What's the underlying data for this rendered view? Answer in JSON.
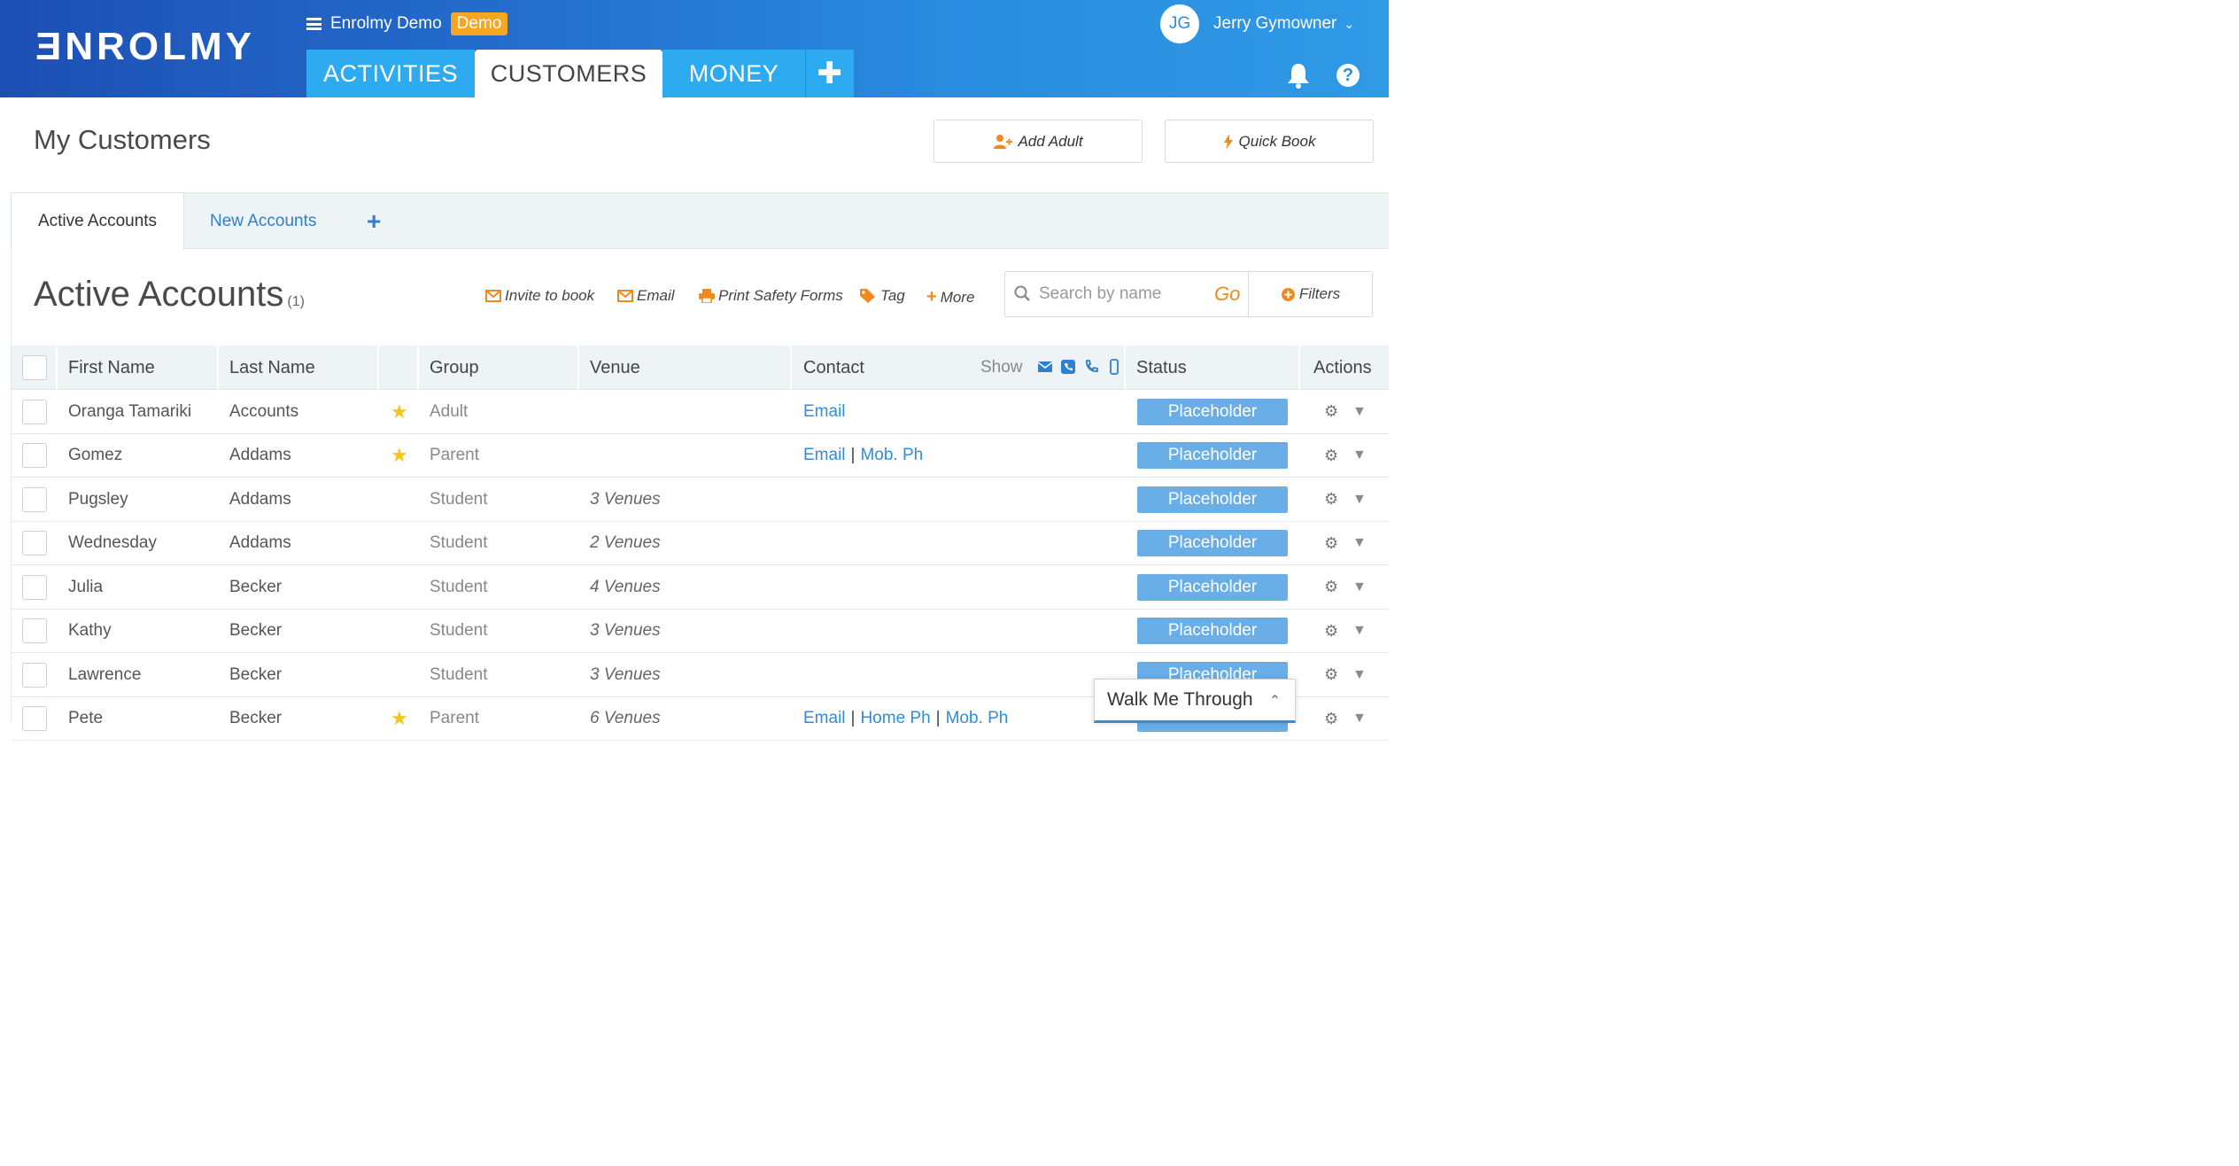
{
  "header": {
    "logo": "ƎNROLMY",
    "org_name": "Enrolmy Demo",
    "org_badge": "Demo",
    "nav_tabs": [
      {
        "label": "ACTIVITIES"
      },
      {
        "label": "CUSTOMERS"
      },
      {
        "label": "MONEY"
      },
      {
        "label": "✚"
      }
    ],
    "user_initials": "JG",
    "user_name": "Jerry Gymowner",
    "help_label": "?"
  },
  "page": {
    "title": "My Customers",
    "add_adult_label": "Add Adult",
    "quick_book_label": "Quick Book"
  },
  "subtabs": {
    "active": "Active Accounts",
    "new": "New Accounts",
    "plus": "+"
  },
  "section": {
    "title": "Active Accounts",
    "count": "(1)",
    "toolbar": {
      "invite": "Invite to book",
      "email": "Email",
      "print": "Print Safety Forms",
      "tag": "Tag",
      "more": "More"
    },
    "search": {
      "placeholder": "Search by name",
      "go": "Go",
      "filters": "Filters"
    }
  },
  "table": {
    "columns": {
      "first_name": "First Name",
      "last_name": "Last Name",
      "group": "Group",
      "venue": "Venue",
      "contact": "Contact",
      "show": "Show",
      "status": "Status",
      "actions": "Actions"
    },
    "rows": [
      {
        "first": "Oranga Tamariki",
        "last": "Accounts",
        "star": "★",
        "group": "Adult",
        "venue": "",
        "contact": [
          "Email"
        ],
        "status": "Placeholder"
      },
      {
        "first": "Gomez",
        "last": "Addams",
        "star": "★",
        "group": "Parent",
        "venue": "",
        "contact": [
          "Email",
          "Mob. Ph"
        ],
        "status": "Placeholder"
      },
      {
        "first": "Pugsley",
        "last": "Addams",
        "star": "",
        "group": "Student",
        "venue": "3 Venues",
        "contact": [],
        "status": "Placeholder"
      },
      {
        "first": "Wednesday",
        "last": "Addams",
        "star": "",
        "group": "Student",
        "venue": "2 Venues",
        "contact": [],
        "status": "Placeholder"
      },
      {
        "first": "Julia",
        "last": "Becker",
        "star": "",
        "group": "Student",
        "venue": "4 Venues",
        "contact": [],
        "status": "Placeholder"
      },
      {
        "first": "Kathy",
        "last": "Becker",
        "star": "",
        "group": "Student",
        "venue": "3 Venues",
        "contact": [],
        "status": "Placeholder"
      },
      {
        "first": "Lawrence",
        "last": "Becker",
        "star": "",
        "group": "Student",
        "venue": "3 Venues",
        "contact": [],
        "status": "Placeholder"
      },
      {
        "first": "Pete",
        "last": "Becker",
        "star": "★",
        "group": "Parent",
        "venue": "6 Venues",
        "contact": [
          "Email",
          "Home Ph",
          "Mob. Ph"
        ],
        "status": "Placeholder"
      }
    ]
  },
  "walkme": {
    "label": "Walk Me Through"
  },
  "colors": {
    "header_start": "#1d4fb3",
    "header_end": "#2f9ae6",
    "tab_blue": "#2eaaf0",
    "accent_orange": "#f08a1c",
    "link_blue": "#2f8dd9",
    "status_blue": "#6aaee8",
    "star_yellow": "#f5c518"
  }
}
